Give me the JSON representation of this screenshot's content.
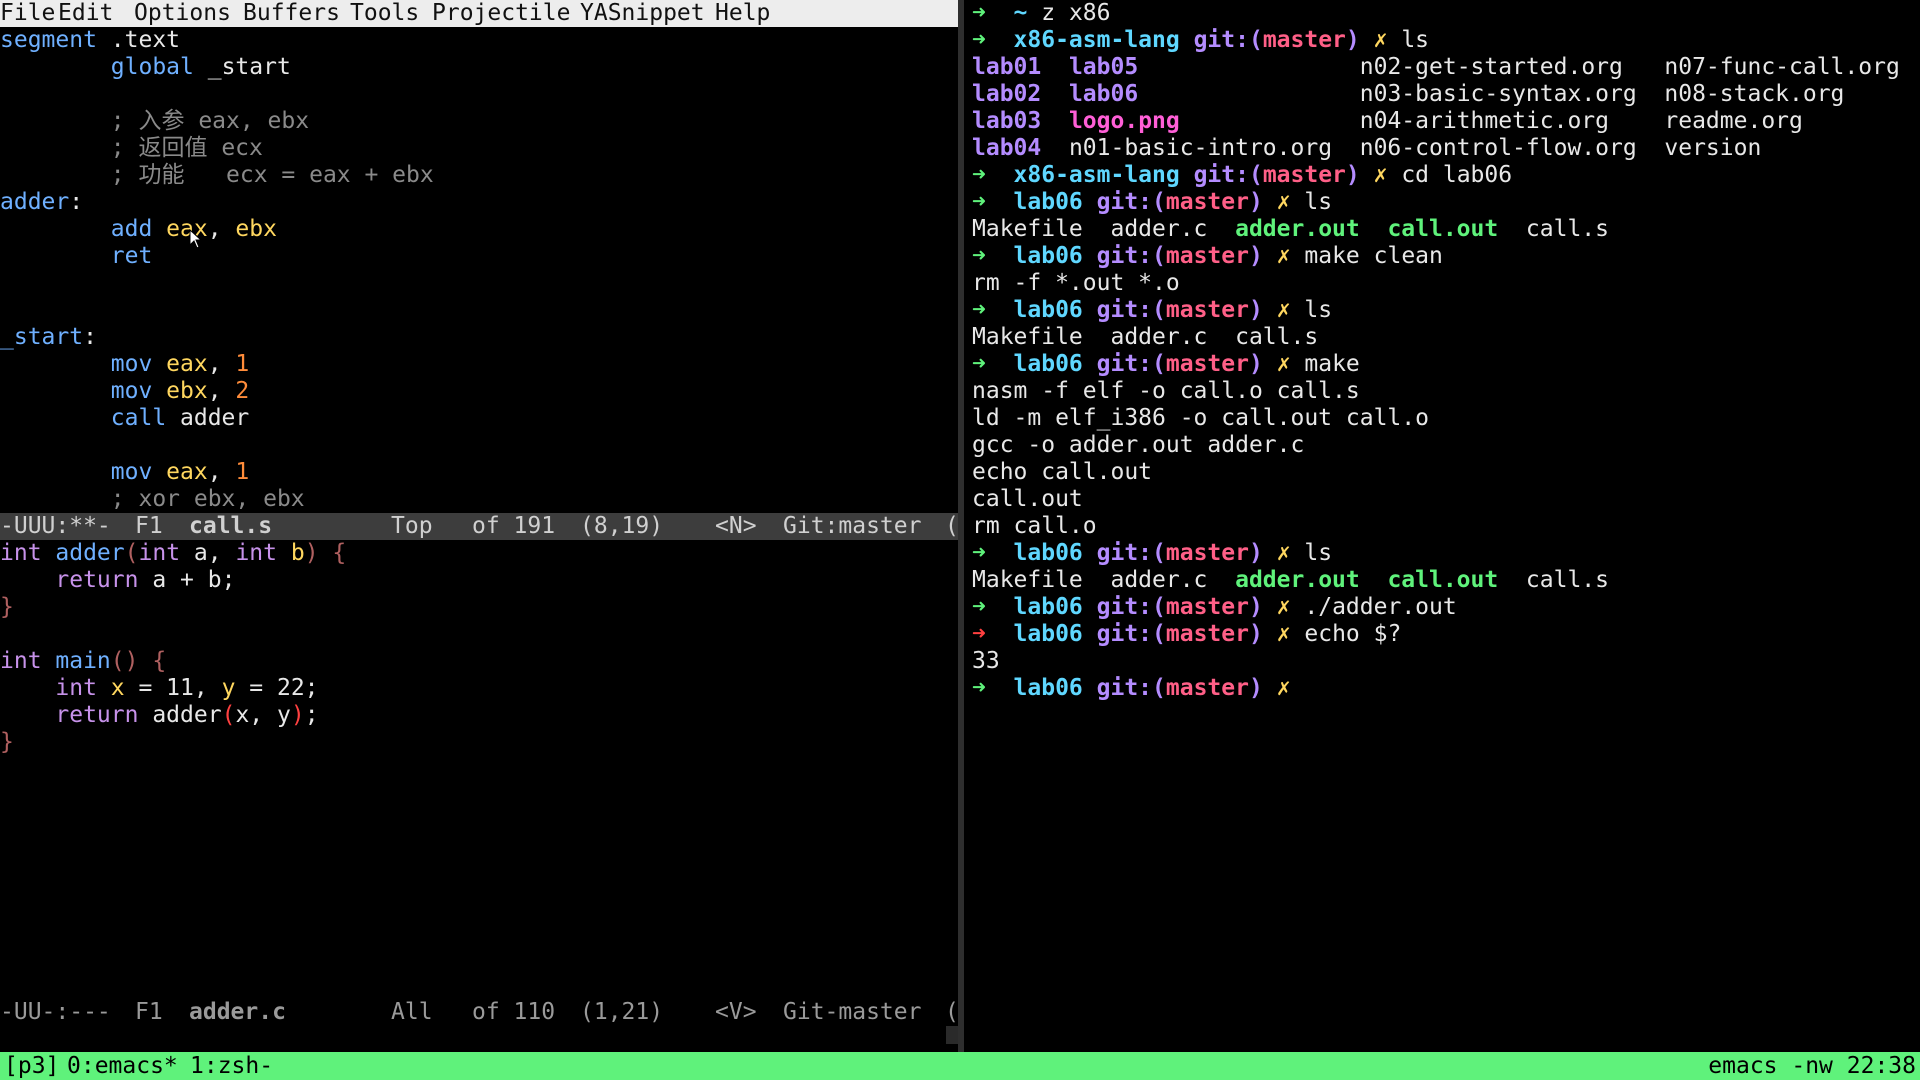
{
  "emacs": {
    "menu": [
      "File",
      "Edit",
      "Options",
      "Buffers",
      "Tools",
      "Projectile",
      "YASnippet",
      "Help"
    ],
    "asm_buffer": {
      "lines": [
        [
          {
            "t": "segment",
            "c": "#6fb0ff"
          },
          {
            "t": " .text",
            "c": "#e8e8e8"
          }
        ],
        [
          {
            "t": "        global",
            "c": "#6fb0ff"
          },
          {
            "t": " _start",
            "c": "#e8e8e8"
          }
        ],
        [],
        [
          {
            "t": "        ; 入参 eax, ebx",
            "c": "#8a8a8a"
          }
        ],
        [
          {
            "t": "        ; 返回值 ecx",
            "c": "#8a8a8a"
          }
        ],
        [
          {
            "t": "        ; 功能   ecx = eax + ebx",
            "c": "#8a8a8a"
          }
        ],
        [
          {
            "t": "adder",
            "c": "#6fb0ff"
          },
          {
            "t": ":",
            "c": "#e8e8e8"
          }
        ],
        [
          {
            "t": "        add",
            "c": "#6fb0ff"
          },
          {
            "t": " eax",
            "c": "#ffd75f"
          },
          {
            "t": ", ",
            "c": "#e8e8e8"
          },
          {
            "t": "ebx",
            "c": "#ffd75f"
          }
        ],
        [
          {
            "t": "        ret",
            "c": "#6fb0ff"
          }
        ],
        [],
        [],
        [
          {
            "t": "_start",
            "c": "#6fb0ff"
          },
          {
            "t": ":",
            "c": "#e8e8e8"
          }
        ],
        [
          {
            "t": "        mov",
            "c": "#6fb0ff"
          },
          {
            "t": " eax",
            "c": "#ffd75f"
          },
          {
            "t": ", ",
            "c": "#e8e8e8"
          },
          {
            "t": "1",
            "c": "#ff8c3a"
          }
        ],
        [
          {
            "t": "        mov",
            "c": "#6fb0ff"
          },
          {
            "t": " ebx",
            "c": "#ffd75f"
          },
          {
            "t": ", ",
            "c": "#e8e8e8"
          },
          {
            "t": "2",
            "c": "#ff8c3a"
          }
        ],
        [
          {
            "t": "        call",
            "c": "#6fb0ff"
          },
          {
            "t": " adder",
            "c": "#e8e8e8"
          }
        ],
        [],
        [
          {
            "t": "        mov",
            "c": "#6fb0ff"
          },
          {
            "t": " eax",
            "c": "#ffd75f"
          },
          {
            "t": ", ",
            "c": "#e8e8e8"
          },
          {
            "t": "1",
            "c": "#ff8c3a"
          }
        ],
        [
          {
            "t": "        ; xor ebx, ebx",
            "c": "#8a8a8a"
          }
        ]
      ]
    },
    "modeline_asm": {
      "status": "-UUU:**-",
      "frame": "F1",
      "buffer": "call.s",
      "position": "Top",
      "size": "of 191",
      "cursor": "(8,19)",
      "input": "<N>",
      "vc": "Git:master",
      "paren": "("
    },
    "c_buffer": {
      "lines": [
        [
          {
            "t": "int",
            "c": "#c792ea"
          },
          {
            "t": " adder",
            "c": "#6fb0ff"
          },
          {
            "t": "(",
            "c": "#b06060"
          },
          {
            "t": "int",
            "c": "#c792ea"
          },
          {
            "t": " a, ",
            "c": "#e8e8e8"
          },
          {
            "t": "int",
            "c": "#c792ea"
          },
          {
            "t": " b",
            "c": "#ffd75f"
          },
          {
            "t": ") {",
            "c": "#b06060"
          }
        ],
        [
          {
            "t": "    return",
            "c": "#c792ea"
          },
          {
            "t": " a + b;",
            "c": "#e8e8e8"
          }
        ],
        [
          {
            "t": "}",
            "c": "#b06060"
          }
        ],
        [],
        [
          {
            "t": "int",
            "c": "#c792ea"
          },
          {
            "t": " main",
            "c": "#6fb0ff"
          },
          {
            "t": "() {",
            "c": "#b06060"
          }
        ],
        [
          {
            "t": "    int",
            "c": "#c792ea"
          },
          {
            "t": " x",
            "c": "#ffd75f"
          },
          {
            "t": " = 11, ",
            "c": "#e8e8e8"
          },
          {
            "t": "y",
            "c": "#ffd75f"
          },
          {
            "t": " = 22;",
            "c": "#e8e8e8"
          }
        ],
        [
          {
            "t": "    return",
            "c": "#c792ea"
          },
          {
            "t": " adder",
            "c": "#e8e8e8"
          },
          {
            "t": "(",
            "c": "#ff4040"
          },
          {
            "t": "x, y",
            "c": "#e8e8e8"
          },
          {
            "t": ")",
            "c": "#ff4040"
          },
          {
            "t": ";",
            "c": "#e8e8e8"
          }
        ],
        [
          {
            "t": "}",
            "c": "#b06060"
          }
        ]
      ]
    },
    "modeline_c": {
      "status": "-UU-:---",
      "frame": "F1",
      "buffer": "adder.c",
      "position": "All",
      "size": "of 110",
      "cursor": "(1,21)",
      "input": "<V>",
      "vc": "Git-master",
      "paren": "("
    }
  },
  "terminal": {
    "lines": [
      [
        {
          "t": "➜  ",
          "c": "#5ff27b"
        },
        {
          "t": "~ ",
          "c": "#5fd7ff",
          "b": true
        },
        {
          "t": "z x86",
          "c": "#e8e8e8"
        }
      ],
      [
        {
          "t": "➜  ",
          "c": "#5ff27b"
        },
        {
          "t": "x86-asm-lang ",
          "c": "#5fd7ff",
          "b": true
        },
        {
          "t": "git:(",
          "c": "#b48cff",
          "b": true
        },
        {
          "t": "master",
          "c": "#ff5f87",
          "b": true
        },
        {
          "t": ")",
          "c": "#b48cff",
          "b": true
        },
        {
          "t": " ✗ ",
          "c": "#ffd75f",
          "b": true
        },
        {
          "t": "ls",
          "c": "#e8e8e8"
        }
      ],
      [
        {
          "t": "lab01",
          "c": "#b48cff",
          "b": true
        },
        {
          "t": "  ",
          "c": "#e8e8e8"
        },
        {
          "t": "lab05",
          "c": "#b48cff",
          "b": true
        },
        {
          "t": "                n02-get-started.org   n07-func-call.org",
          "c": "#e8e8e8"
        }
      ],
      [
        {
          "t": "lab02",
          "c": "#b48cff",
          "b": true
        },
        {
          "t": "  ",
          "c": "#e8e8e8"
        },
        {
          "t": "lab06",
          "c": "#b48cff",
          "b": true
        },
        {
          "t": "                n03-basic-syntax.org  n08-stack.org",
          "c": "#e8e8e8"
        }
      ],
      [
        {
          "t": "lab03",
          "c": "#b48cff",
          "b": true
        },
        {
          "t": "  ",
          "c": "#e8e8e8"
        },
        {
          "t": "logo.png",
          "c": "#ff5fd7",
          "b": true
        },
        {
          "t": "             n04-arithmetic.org    readme.org",
          "c": "#e8e8e8"
        }
      ],
      [
        {
          "t": "lab04",
          "c": "#b48cff",
          "b": true
        },
        {
          "t": "  n01-basic-intro.org  n06-control-flow.org  version",
          "c": "#e8e8e8"
        }
      ],
      [
        {
          "t": "➜  ",
          "c": "#5ff27b"
        },
        {
          "t": "x86-asm-lang ",
          "c": "#5fd7ff",
          "b": true
        },
        {
          "t": "git:(",
          "c": "#b48cff",
          "b": true
        },
        {
          "t": "master",
          "c": "#ff5f87",
          "b": true
        },
        {
          "t": ")",
          "c": "#b48cff",
          "b": true
        },
        {
          "t": " ✗ ",
          "c": "#ffd75f",
          "b": true
        },
        {
          "t": "cd lab06",
          "c": "#e8e8e8"
        }
      ],
      [
        {
          "t": "➜  ",
          "c": "#5ff27b"
        },
        {
          "t": "lab06 ",
          "c": "#5fd7ff",
          "b": true
        },
        {
          "t": "git:(",
          "c": "#b48cff",
          "b": true
        },
        {
          "t": "master",
          "c": "#ff5f87",
          "b": true
        },
        {
          "t": ")",
          "c": "#b48cff",
          "b": true
        },
        {
          "t": " ✗ ",
          "c": "#ffd75f",
          "b": true
        },
        {
          "t": "ls",
          "c": "#e8e8e8"
        }
      ],
      [
        {
          "t": "Makefile  adder.c  ",
          "c": "#e8e8e8"
        },
        {
          "t": "adder.out",
          "c": "#5ff27b",
          "b": true
        },
        {
          "t": "  ",
          "c": "#e8e8e8"
        },
        {
          "t": "call.out",
          "c": "#5ff27b",
          "b": true
        },
        {
          "t": "  call.s",
          "c": "#e8e8e8"
        }
      ],
      [
        {
          "t": "➜  ",
          "c": "#5ff27b"
        },
        {
          "t": "lab06 ",
          "c": "#5fd7ff",
          "b": true
        },
        {
          "t": "git:(",
          "c": "#b48cff",
          "b": true
        },
        {
          "t": "master",
          "c": "#ff5f87",
          "b": true
        },
        {
          "t": ")",
          "c": "#b48cff",
          "b": true
        },
        {
          "t": " ✗ ",
          "c": "#ffd75f",
          "b": true
        },
        {
          "t": "make clean",
          "c": "#e8e8e8"
        }
      ],
      [
        {
          "t": "rm -f *.out *.o",
          "c": "#e8e8e8"
        }
      ],
      [
        {
          "t": "➜  ",
          "c": "#5ff27b"
        },
        {
          "t": "lab06 ",
          "c": "#5fd7ff",
          "b": true
        },
        {
          "t": "git:(",
          "c": "#b48cff",
          "b": true
        },
        {
          "t": "master",
          "c": "#ff5f87",
          "b": true
        },
        {
          "t": ")",
          "c": "#b48cff",
          "b": true
        },
        {
          "t": " ✗ ",
          "c": "#ffd75f",
          "b": true
        },
        {
          "t": "ls",
          "c": "#e8e8e8"
        }
      ],
      [
        {
          "t": "Makefile  adder.c  call.s",
          "c": "#e8e8e8"
        }
      ],
      [
        {
          "t": "➜  ",
          "c": "#5ff27b"
        },
        {
          "t": "lab06 ",
          "c": "#5fd7ff",
          "b": true
        },
        {
          "t": "git:(",
          "c": "#b48cff",
          "b": true
        },
        {
          "t": "master",
          "c": "#ff5f87",
          "b": true
        },
        {
          "t": ")",
          "c": "#b48cff",
          "b": true
        },
        {
          "t": " ✗ ",
          "c": "#ffd75f",
          "b": true
        },
        {
          "t": "make",
          "c": "#e8e8e8"
        }
      ],
      [
        {
          "t": "nasm -f elf -o call.o call.s",
          "c": "#e8e8e8"
        }
      ],
      [
        {
          "t": "ld -m elf_i386 -o call.out call.o",
          "c": "#e8e8e8"
        }
      ],
      [
        {
          "t": "gcc -o adder.out adder.c",
          "c": "#e8e8e8"
        }
      ],
      [
        {
          "t": "echo call.out",
          "c": "#e8e8e8"
        }
      ],
      [
        {
          "t": "call.out",
          "c": "#e8e8e8"
        }
      ],
      [
        {
          "t": "rm call.o",
          "c": "#e8e8e8"
        }
      ],
      [
        {
          "t": "➜  ",
          "c": "#5ff27b"
        },
        {
          "t": "lab06 ",
          "c": "#5fd7ff",
          "b": true
        },
        {
          "t": "git:(",
          "c": "#b48cff",
          "b": true
        },
        {
          "t": "master",
          "c": "#ff5f87",
          "b": true
        },
        {
          "t": ")",
          "c": "#b48cff",
          "b": true
        },
        {
          "t": " ✗ ",
          "c": "#ffd75f",
          "b": true
        },
        {
          "t": "ls",
          "c": "#e8e8e8"
        }
      ],
      [
        {
          "t": "Makefile  adder.c  ",
          "c": "#e8e8e8"
        },
        {
          "t": "adder.out",
          "c": "#5ff27b",
          "b": true
        },
        {
          "t": "  ",
          "c": "#e8e8e8"
        },
        {
          "t": "call.out",
          "c": "#5ff27b",
          "b": true
        },
        {
          "t": "  call.s",
          "c": "#e8e8e8"
        }
      ],
      [
        {
          "t": "➜  ",
          "c": "#5ff27b"
        },
        {
          "t": "lab06 ",
          "c": "#5fd7ff",
          "b": true
        },
        {
          "t": "git:(",
          "c": "#b48cff",
          "b": true
        },
        {
          "t": "master",
          "c": "#ff5f87",
          "b": true
        },
        {
          "t": ")",
          "c": "#b48cff",
          "b": true
        },
        {
          "t": " ✗ ",
          "c": "#ffd75f",
          "b": true
        },
        {
          "t": "./adder.out",
          "c": "#e8e8e8"
        }
      ],
      [
        {
          "t": "➜  ",
          "c": "#ff4040"
        },
        {
          "t": "lab06 ",
          "c": "#5fd7ff",
          "b": true
        },
        {
          "t": "git:(",
          "c": "#b48cff",
          "b": true
        },
        {
          "t": "master",
          "c": "#ff5f87",
          "b": true
        },
        {
          "t": ")",
          "c": "#b48cff",
          "b": true
        },
        {
          "t": " ✗ ",
          "c": "#ffd75f",
          "b": true
        },
        {
          "t": "echo $?",
          "c": "#e8e8e8"
        }
      ],
      [
        {
          "t": "33",
          "c": "#e8e8e8"
        }
      ],
      [
        {
          "t": "➜  ",
          "c": "#5ff27b"
        },
        {
          "t": "lab06 ",
          "c": "#5fd7ff",
          "b": true
        },
        {
          "t": "git:(",
          "c": "#b48cff",
          "b": true
        },
        {
          "t": "master",
          "c": "#ff5f87",
          "b": true
        },
        {
          "t": ")",
          "c": "#b48cff",
          "b": true
        },
        {
          "t": " ✗ ",
          "c": "#ffd75f",
          "b": true
        }
      ]
    ]
  },
  "tmux": {
    "session": "[p3]",
    "windows": [
      "0:emacs*",
      "1:zsh-"
    ],
    "right": "emacs -nw 22:38"
  },
  "icons": {
    "mouse_cursor": "mouse-pointer-icon"
  }
}
